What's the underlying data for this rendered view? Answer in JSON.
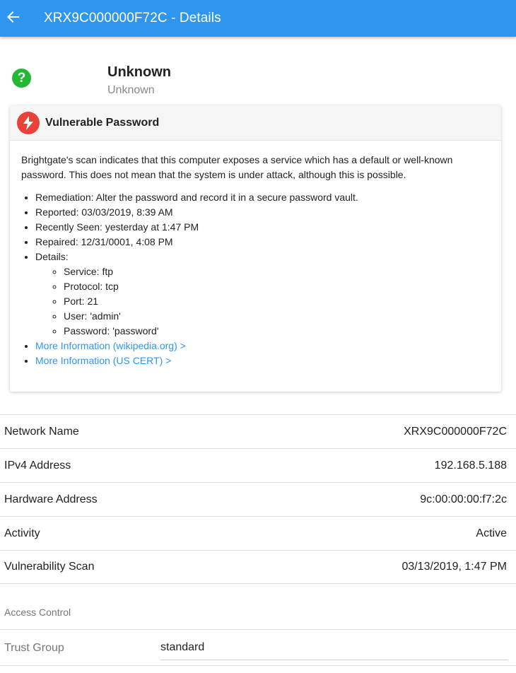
{
  "nav": {
    "title": "XRX9C000000F72C - Details",
    "back_icon": "arrow-left-icon",
    "color": "#2f96ef"
  },
  "device": {
    "name": "Unknown",
    "subtitle": "Unknown",
    "status_icon": "question-mark-icon",
    "status_symbol": "?",
    "status_color": "#22b833"
  },
  "vulnerability": {
    "title": "Vulnerable Password",
    "icon": "lightning-bolt-icon",
    "icon_color": "#e8423a",
    "description": "Brightgate's scan indicates that this computer exposes a service which has a default or well-known password. This does not mean that the system is under attack, although this is possible.",
    "remediation": "Remediation: Alter the password and record it in a secure password vault.",
    "reported": "Reported: 03/03/2019, 8:39 AM",
    "recently_seen": "Recently Seen: yesterday at 1:47 PM",
    "repaired": "Repaired: 12/31/0001, 4:08 PM",
    "details_label": "Details:",
    "details": [
      "Service: ftp",
      "Protocol: tcp",
      "Port: 21",
      "User: 'admin'",
      "Password: 'password'"
    ],
    "links": [
      "More Information (wikipedia.org) >",
      "More Information (US CERT) >"
    ],
    "link_color": "#2f96ef"
  },
  "info": [
    {
      "label": "Network Name",
      "value": "XRX9C000000F72C"
    },
    {
      "label": "IPv4 Address",
      "value": "192.168.5.188"
    },
    {
      "label": "Hardware Address",
      "value": "9c:00:00:00:f7:2c"
    },
    {
      "label": "Activity",
      "value": "Active"
    },
    {
      "label": "Vulnerability Scan",
      "value": "03/13/2019, 1:47 PM"
    }
  ],
  "access_control": {
    "section_title": "Access Control",
    "trust_group_label": "Trust Group",
    "trust_group_value": "standard"
  }
}
